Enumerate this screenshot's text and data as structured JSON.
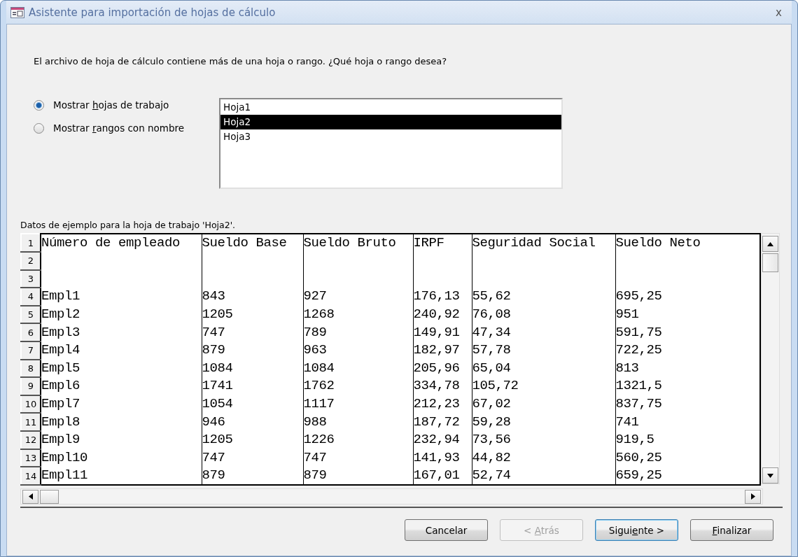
{
  "window": {
    "title": "Asistente para importación de hojas de cálculo",
    "close": "x"
  },
  "prompt": "El archivo de hoja de cálculo contiene más de una hoja o rango. ¿Qué hoja o rango desea?",
  "options": [
    {
      "label": {
        "before": "Mostrar ",
        "key": "h",
        "after": "ojas de trabajo"
      },
      "selected": true
    },
    {
      "label": {
        "before": "Mostrar ",
        "key": "r",
        "after": "angos con nombre"
      },
      "selected": false
    }
  ],
  "sheets": [
    {
      "label": "Hoja1",
      "selected": false
    },
    {
      "label": "Hoja2",
      "selected": true
    },
    {
      "label": "Hoja3",
      "selected": false
    }
  ],
  "sample_caption": "Datos de ejemplo para la hoja de trabajo 'Hoja2'.",
  "grid": {
    "rows": [
      {
        "number": "1",
        "cells": [
          "Número de empleado",
          "Sueldo Base",
          "Sueldo Bruto",
          "IRPF",
          "Seguridad Social",
          "Sueldo Neto"
        ]
      },
      {
        "number": "2"
      },
      {
        "number": "3"
      },
      {
        "number": "4",
        "cells": [
          "Empl1",
          "843",
          "927",
          "176,13",
          "55,62",
          "695,25"
        ]
      },
      {
        "number": "5",
        "cells": [
          "Empl2",
          "1205",
          "1268",
          "240,92",
          "76,08",
          "951"
        ]
      },
      {
        "number": "6",
        "cells": [
          "Empl3",
          "747",
          "789",
          "149,91",
          "47,34",
          "591,75"
        ]
      },
      {
        "number": "7",
        "cells": [
          "Empl4",
          "879",
          "963",
          "182,97",
          "57,78",
          "722,25"
        ]
      },
      {
        "number": "8",
        "cells": [
          "Empl5",
          "1084",
          "1084",
          "205,96",
          "65,04",
          "813"
        ]
      },
      {
        "number": "9",
        "cells": [
          "Empl6",
          "1741",
          "1762",
          "334,78",
          "105,72",
          "1321,5"
        ]
      },
      {
        "number": "10",
        "cells": [
          "Empl7",
          "1054",
          "1117",
          "212,23",
          "67,02",
          "837,75"
        ]
      },
      {
        "number": "11",
        "cells": [
          "Empl8",
          "946",
          "988",
          "187,72",
          "59,28",
          "741"
        ]
      },
      {
        "number": "12",
        "cells": [
          "Empl9",
          "1205",
          "1226",
          "232,94",
          "73,56",
          "919,5"
        ]
      },
      {
        "number": "13",
        "cells": [
          "Empl10",
          "747",
          "747",
          "141,93",
          "44,82",
          "560,25"
        ]
      },
      {
        "number": "14",
        "cells": [
          "Empl11",
          "879",
          "879",
          "167,01",
          "52,74",
          "659,25"
        ]
      }
    ]
  },
  "buttons": [
    {
      "label": {
        "before": "Cancelar"
      },
      "disabled": false,
      "focused": false
    },
    {
      "label": {
        "before": "< ",
        "key": "A",
        "after": "trás"
      },
      "disabled": true,
      "focused": false
    },
    {
      "label": {
        "before": "Sigui",
        "key": "e",
        "after": "nte >"
      },
      "disabled": false,
      "focused": true
    },
    {
      "label": {
        "key": "F",
        "after": "inalizar"
      },
      "disabled": false,
      "focused": false
    }
  ]
}
